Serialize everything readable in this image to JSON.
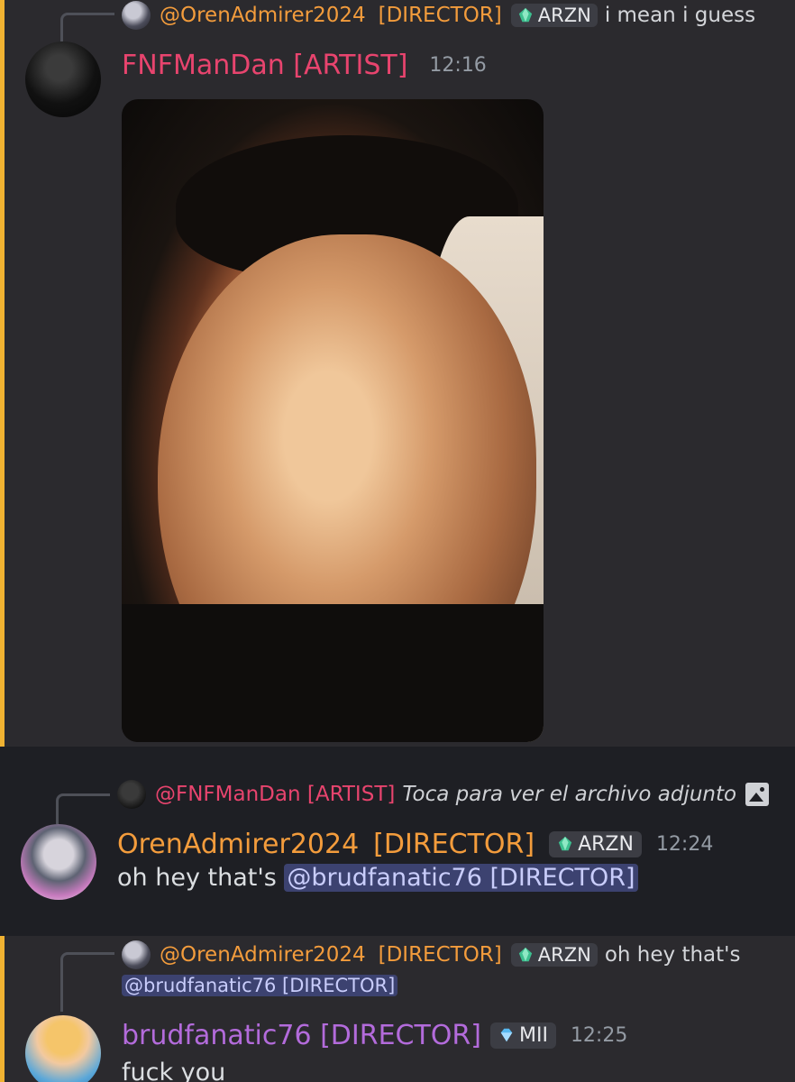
{
  "messages": [
    {
      "reply": {
        "author": "@OrenAdmirer2024",
        "role": "[DIRECTOR]",
        "badge": "ARZN",
        "snippet": "i mean i guess"
      },
      "author": "FNFManDan [ARTIST]",
      "time": "12:16",
      "attachment": "image"
    },
    {
      "reply": {
        "author": "@FNFManDan [ARTIST]",
        "snippet": "Toca para ver el archivo adjunto"
      },
      "author": "OrenAdmirer2024",
      "role": "[DIRECTOR]",
      "badge": "ARZN",
      "time": "12:24",
      "text": "oh hey that's",
      "mention": "@brudfanatic76 [DIRECTOR]"
    },
    {
      "reply": {
        "author": "@OrenAdmirer2024",
        "role": "[DIRECTOR]",
        "badge": "ARZN",
        "snippet": "oh hey that's",
        "mention": "@brudfanatic76 [DIRECTOR]"
      },
      "author": "brudfanatic76 [DIRECTOR]",
      "badge": "MII",
      "time": "12:25",
      "text": "fuck you"
    }
  ],
  "colors": {
    "highlight_bar": "#f0b232",
    "orange_name": "#f39c3c",
    "pink_name": "#e8446e",
    "purple_name": "#b36bdb",
    "mention_bg": "#3c4270"
  }
}
